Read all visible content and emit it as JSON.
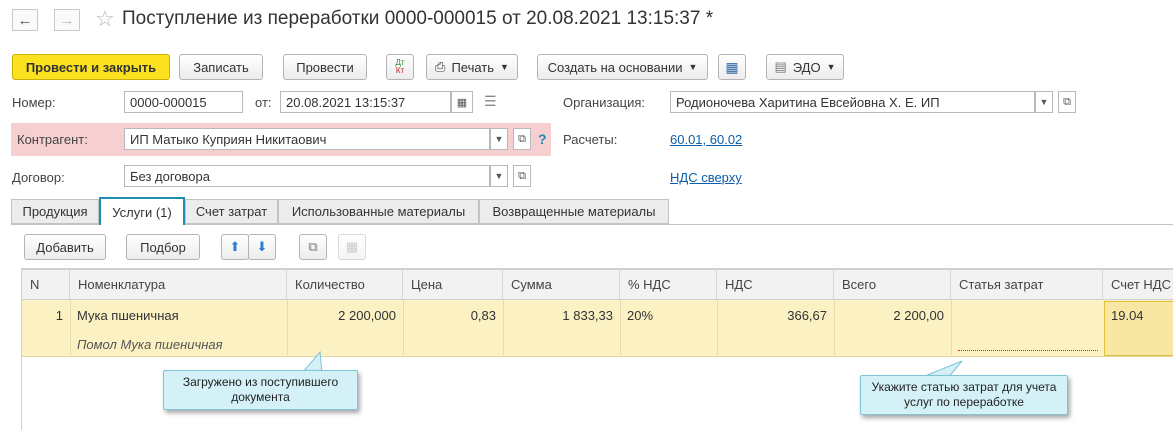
{
  "header": {
    "title": "Поступление из переработки 0000-000015 от 20.08.2021 13:15:37 *"
  },
  "toolbar": {
    "post_close": "Провести и закрыть",
    "save": "Записать",
    "post": "Провести",
    "dtkt_dt": "Дт",
    "dtkt_kt": "Кт",
    "print": "Печать",
    "create_based": "Создать на основании",
    "edo": "ЭДО"
  },
  "form": {
    "number_label": "Номер:",
    "number_value": "0000-000015",
    "date_label": "от:",
    "date_value": "20.08.2021 13:15:37",
    "org_label": "Организация:",
    "org_value": "Родионочева Харитина Евсейовна Х. Е. ИП",
    "counterparty_label": "Контрагент:",
    "counterparty_value": "ИП Матыко Куприян Никитаович",
    "help": "?",
    "settlements_label": "Расчеты:",
    "settlements_value": "60.01, 60.02",
    "contract_label": "Договор:",
    "contract_value": "Без договора",
    "vat_link": "НДС сверху"
  },
  "tabs": [
    {
      "label": "Продукция"
    },
    {
      "label": "Услуги (1)"
    },
    {
      "label": "Счет затрат"
    },
    {
      "label": "Использованные материалы"
    },
    {
      "label": "Возвращенные материалы"
    }
  ],
  "table_toolbar": {
    "add": "Добавить",
    "select": "Подбор"
  },
  "table": {
    "columns": [
      "N",
      "Номенклатура",
      "Количество",
      "Цена",
      "Сумма",
      "% НДС",
      "НДС",
      "Всего",
      "Статья затрат",
      "Счет НДС"
    ],
    "rows": [
      {
        "n": "1",
        "item": "Мука пшеничная",
        "item_sub": "Помол Мука пшеничная",
        "qty": "2 200,000",
        "price": "0,83",
        "sum": "1 833,33",
        "vat_rate": "20%",
        "vat": "366,67",
        "total": "2 200,00",
        "cost_item": "",
        "vat_account": "19.04"
      }
    ]
  },
  "callouts": {
    "left": "Загружено из поступившего документа",
    "right": "Укажите статью затрат для учета услуг по переработке"
  },
  "colors": {
    "accent": "#fce21e",
    "tab_active_border": "#1f8cb4",
    "row_highlight": "#fbf1c3",
    "counterparty_error_bg": "#f6d0d0",
    "callout_bg": "#d3f1f7",
    "link": "#0b5ea9"
  }
}
